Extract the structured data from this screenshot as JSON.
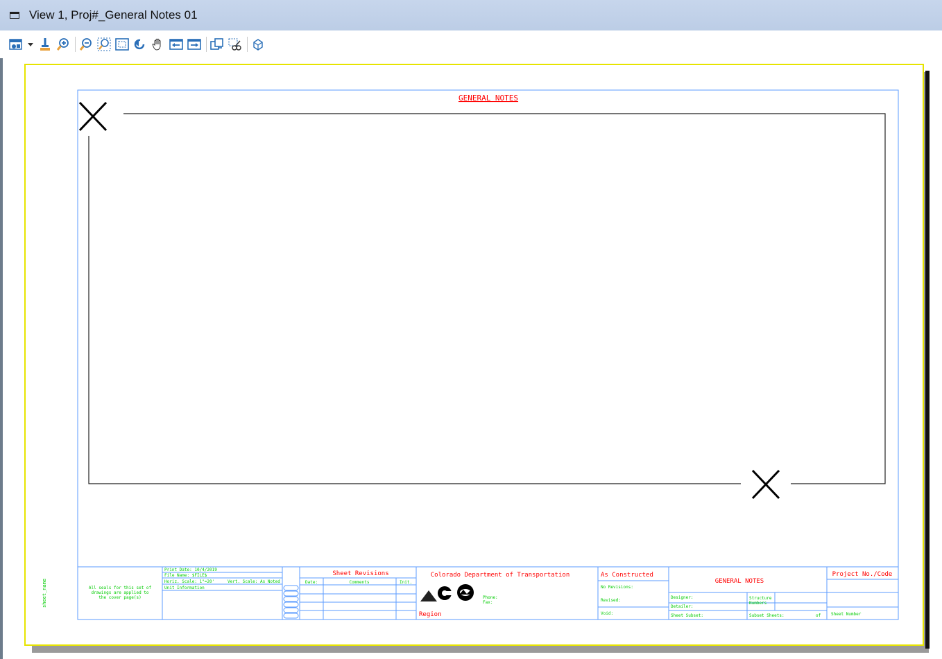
{
  "window": {
    "title": "View 1, Proj#_General Notes 01"
  },
  "toolbar": {
    "icons": [
      "view-attributes-icon",
      "dropdown-arrow-icon",
      "update-view-icon",
      "zoom-in-icon",
      "zoom-out-icon",
      "window-area-icon",
      "fit-view-icon",
      "rotate-view-icon",
      "pan-view-icon",
      "previous-view-icon",
      "next-view-icon",
      "copy-view-icon",
      "clip-volume-icon",
      "view-3d-icon"
    ]
  },
  "sheet": {
    "title": "GENERAL NOTES",
    "left_note": [
      "All seals for this set of",
      "drawings are applied to",
      "the cover page(s)"
    ],
    "vertical_label": "sheet_name",
    "print_info": {
      "print_date": "Print Date: 10/4/2019",
      "file_name": "File Name: $FILE$",
      "horiz_scale": "Horiz. Scale: 1\"=20'",
      "vert_scale": "Vert. Scale: As Noted",
      "units": "Unit Information"
    },
    "revisions": {
      "title": "Sheet Revisions",
      "date": "Date:",
      "comments": "Comments",
      "init": "Init."
    },
    "agency": {
      "name": "Colorado Department of Transportation",
      "phone": "Phone:",
      "fax": "Fax:",
      "region": "Region"
    },
    "as_constructed": {
      "title": "As Constructed",
      "no_revisions": "No Revisions:",
      "revised": "Revised:",
      "void": "Void:"
    },
    "sheet_info": {
      "title": "GENERAL NOTES",
      "designer": "Designer:",
      "detailer": "Detailer:",
      "structure_numbers": [
        "Structure",
        "Numbers"
      ],
      "sheet_subset": "Sheet Subset:",
      "subset_sheets": "Subset Sheets:",
      "of": "of"
    },
    "project": {
      "title": "Project No./Code",
      "sheet_number": "Sheet Number"
    }
  }
}
